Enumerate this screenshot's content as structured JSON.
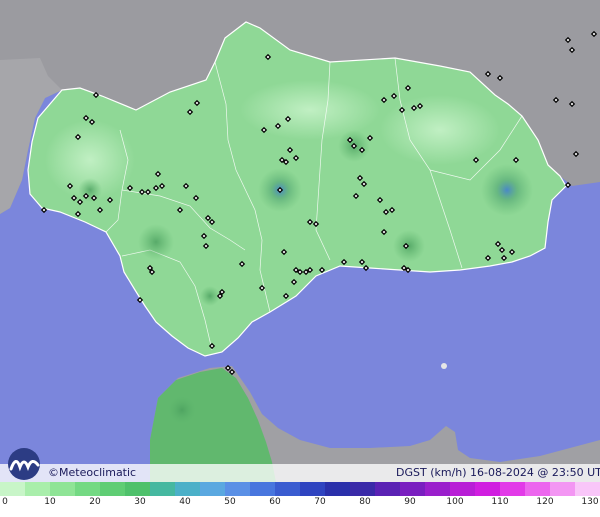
{
  "map": {
    "credit": "©Meteoclimatic",
    "variable": "DGST (km/h)",
    "timestamp": "16-08-2024 @ 23:50 UTC",
    "colors": {
      "sea": "#7b86dc",
      "land_outside": "#9a9a9e",
      "region": "#8fd896",
      "region_dark": "#5ab36a",
      "border": "#ffffff",
      "station": "#000000"
    },
    "legend": {
      "ticks": [
        "0",
        "10",
        "20",
        "30",
        "40",
        "50",
        "60",
        "70",
        "80",
        "90",
        "100",
        "110",
        "120",
        "130"
      ],
      "colors": [
        "#c8f5c8",
        "#a9eeab",
        "#8fe496",
        "#74d983",
        "#5fcd74",
        "#4fc16b",
        "#45b8a0",
        "#4bb0c8",
        "#5aa8e0",
        "#5a90e6",
        "#4876de",
        "#3a5cd0",
        "#2f44c0",
        "#2a30aa",
        "#3a2aa8",
        "#5a22b4",
        "#7a1fc0",
        "#9a1fcc",
        "#b81ed6",
        "#d01ee0",
        "#e23ae8",
        "#ec66ee",
        "#f396f3",
        "#f9c6f9"
      ]
    }
  }
}
